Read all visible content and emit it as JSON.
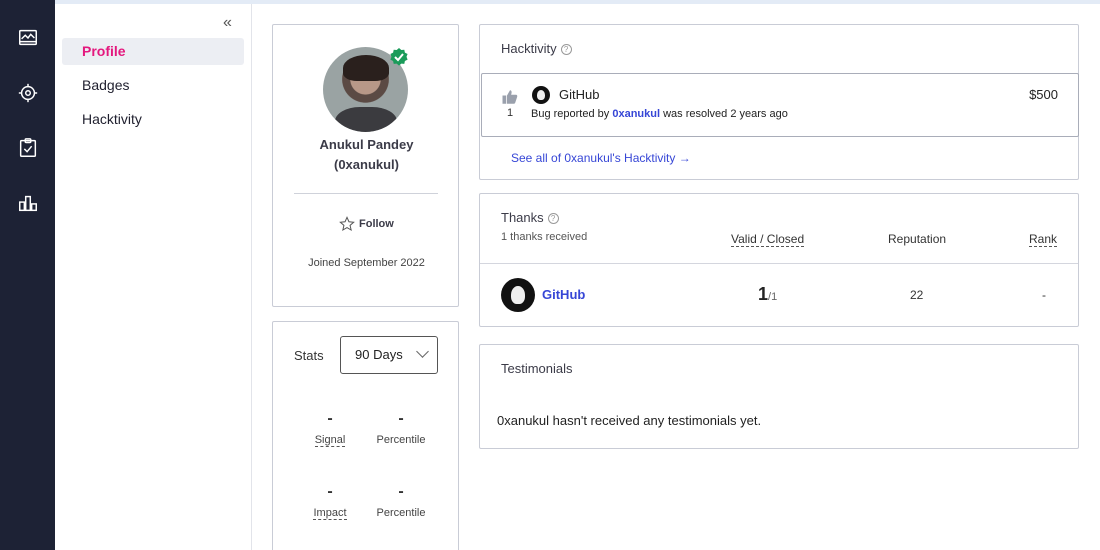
{
  "rail": {
    "icons": [
      "dashboard-icon",
      "opportunities-icon",
      "reports-icon",
      "analytics-icon"
    ]
  },
  "subnav": {
    "collapse_glyph": "«",
    "items": [
      {
        "label": "Profile",
        "active": true
      },
      {
        "label": "Badges",
        "active": false
      },
      {
        "label": "Hacktivity",
        "active": false
      }
    ]
  },
  "profile": {
    "name": "Anukul Pandey",
    "handle": "(0xanukul)",
    "follow_label": "Follow",
    "joined": "Joined September 2022"
  },
  "stats": {
    "label": "Stats",
    "range_selected": "90 Days",
    "signal": {
      "value": "-",
      "label": "Signal"
    },
    "signal_percentile": {
      "value": "-",
      "label": "Percentile"
    },
    "impact": {
      "value": "-",
      "label": "Impact"
    },
    "impact_percentile": {
      "value": "-",
      "label": "Percentile"
    }
  },
  "hacktivity": {
    "title": "Hacktivity",
    "item": {
      "votes": "1",
      "program": "GitHub",
      "desc_prefix": "Bug reported by",
      "reporter": "0xanukul",
      "desc_suffix": "was resolved 2 years ago",
      "bounty": "$500"
    },
    "see_all": "See all of 0xanukul's Hacktivity →"
  },
  "thanks": {
    "title": "Thanks",
    "subtitle": "1 thanks received",
    "col_valid": "Valid / Closed",
    "col_reputation": "Reputation",
    "col_rank": "Rank",
    "row": {
      "program": "GitHub",
      "valid": "1",
      "closed": "/1",
      "reputation": "22",
      "rank": "-"
    }
  },
  "testimonials": {
    "title": "Testimonials",
    "message": "0xanukul hasn't received any testimonials yet."
  },
  "colors": {
    "accent": "#e4187e",
    "link": "#3646d6",
    "rail_bg": "#1d2235",
    "verified": "#1a9b5a"
  }
}
